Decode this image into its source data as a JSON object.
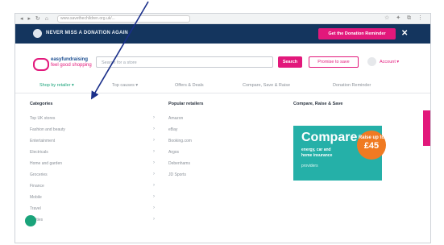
{
  "browser": {
    "nav_icons": "◂ ▸ ↻ ⌂",
    "url": "www.savethechildren.org.uk/...",
    "tools": "☆ ✦ ⧉ ⋮"
  },
  "banner": {
    "text": "NEVER MISS A DONATION AGAIN",
    "cta": "Get the Donation Reminder",
    "close": "✕"
  },
  "header": {
    "brand_name": "easyfundraising",
    "brand_tagline": "feel good shopping",
    "search_placeholder": "Search for a store",
    "search_button": "Search",
    "promise_button": "Promise to save",
    "account_label": "Account ▾"
  },
  "menu": [
    "Shop by retailer ▾",
    "Top causes ▾",
    "Offers & Deals",
    "Compare, Save & Raise",
    "Donation Reminder"
  ],
  "dropdown": {
    "categories_title": "Categories",
    "popular_title": "Popular retailers",
    "compare_title": "Compare, Raise & Save",
    "categories": [
      "Top UK stores",
      "Fashion and beauty",
      "Entertainment",
      "Electricals",
      "Home and garden",
      "Groceries",
      "Finance",
      "Mobile",
      "Travel",
      "Utilities"
    ],
    "popular": [
      "Amazon",
      "eBay",
      "Booking.com",
      "Argos",
      "Debenhams",
      "JD Sports"
    ]
  },
  "promo": {
    "title": "Compare",
    "line1": "energy, car and",
    "line2": "home insurance",
    "line3": "providers",
    "badge_top": "Raise up to",
    "badge_amount": "£45"
  },
  "colors": {
    "brand_pink": "#e2187b",
    "banner_navy": "#14355e",
    "teal": "#25b0a8",
    "green": "#1aa37a",
    "orange": "#f07a22"
  }
}
